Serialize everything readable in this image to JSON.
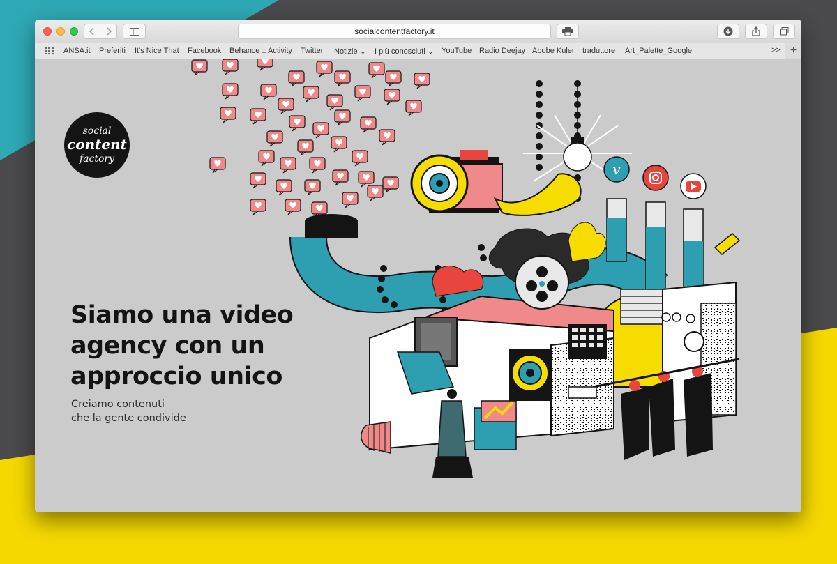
{
  "background": {
    "teal": "#2ea8b4",
    "dark": "#4a4a4c",
    "yellow": "#f5d800"
  },
  "browser": {
    "url": "socialcontentfactory.it",
    "bookmarks": [
      "ANSA.it",
      "Preferiti",
      "It's Nice That",
      "Facebook",
      "Behance :: Activity",
      "Twitter",
      "Notizie",
      "I più conosciuti",
      "YouTube",
      "Radio Deejay",
      "Abobe Kuler",
      "traduttore",
      "Art_Palette_Google"
    ],
    "bookmarks_overflow": ">>",
    "new_tab": "+"
  },
  "site": {
    "logo": {
      "line1": "social",
      "line2": "content",
      "line3": "factory"
    },
    "headline": [
      "Siamo una video",
      "agency con un",
      "approccio unico"
    ],
    "subline": [
      "Creiamo contenuti",
      "che la gente condivide"
    ]
  },
  "illustration": {
    "icons": [
      "heart-reaction-icon",
      "vimeo-icon",
      "instagram-icon",
      "youtube-icon",
      "light-bulb-icon",
      "camera-eye-icon",
      "film-reel-icon"
    ],
    "colors": {
      "pink": "#f08a8a",
      "teal": "#2e9fb0",
      "yellow": "#f6dc00",
      "red": "#e8453c",
      "black": "#141414",
      "white": "#ffffff"
    }
  }
}
